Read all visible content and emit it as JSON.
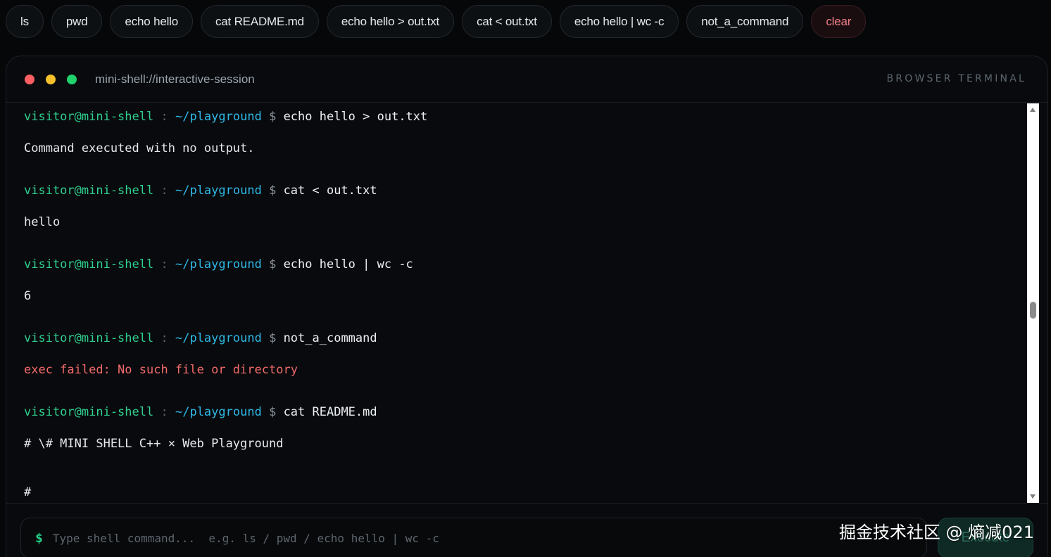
{
  "chips": [
    {
      "label": "ls"
    },
    {
      "label": "pwd"
    },
    {
      "label": "echo hello"
    },
    {
      "label": "cat README.md"
    },
    {
      "label": "echo hello > out.txt"
    },
    {
      "label": "cat < out.txt"
    },
    {
      "label": "echo hello | wc -c"
    },
    {
      "label": "not_a_command"
    },
    {
      "label": "clear"
    }
  ],
  "window": {
    "title": "mini-shell://interactive-session",
    "badge": "BROWSER TERMINAL"
  },
  "prompt": {
    "user": "visitor@mini-shell",
    "sep": ":",
    "path": "~/playground",
    "dollar": "$"
  },
  "history": [
    {
      "command": "echo hello > out.txt",
      "output": "Command executed with no output.",
      "error": false
    },
    {
      "command": "cat < out.txt",
      "output": "hello",
      "error": false
    },
    {
      "command": "echo hello | wc -c",
      "output": "6",
      "error": false
    },
    {
      "command": "not_a_command",
      "output": "exec failed: No such file or directory",
      "error": true
    },
    {
      "command": "cat README.md",
      "output": "# \\# MINI SHELL C++ × Web Playground",
      "error": false
    }
  ],
  "trailing_output": "#",
  "input": {
    "dollar": "$",
    "value": "",
    "placeholder": "Type shell command...  e.g. ls / pwd / echo hello | wc -c"
  },
  "execute_label": "Execute",
  "watermark": "掘金技术社区 @ 熵减021",
  "colors": {
    "prompt_user": "#2fcf8f",
    "prompt_path": "#2fb8e6",
    "error": "#f06a6a",
    "clear_chip": "#f07f89"
  }
}
